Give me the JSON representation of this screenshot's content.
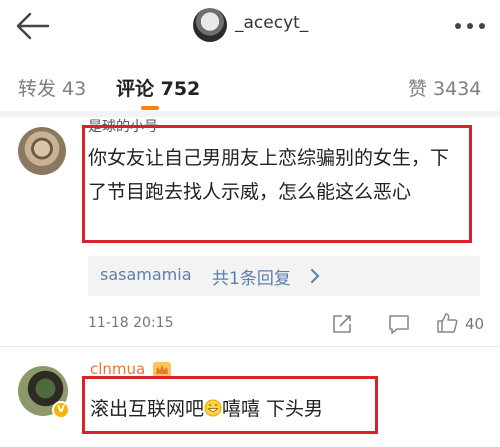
{
  "header": {
    "username": "_acecyt_",
    "back_icon": "back-arrow-icon",
    "more_icon": "more-dots-icon"
  },
  "tabs": {
    "repost": "转发 43",
    "comments": "评论 752",
    "likes": "赞 3434"
  },
  "comments": [
    {
      "username": "是球的小号",
      "text": "你女友让自己男朋友上恋综骗别的女生，下了节目跑去找人示威，怎么能这么恶心",
      "reply_preview": {
        "user": "sasamamia",
        "count_text": "共1条回复"
      },
      "date": "11-18 20:15",
      "like_count": "40"
    },
    {
      "username": "clnmua",
      "text_before_emoji": "滚出互联网吧",
      "text_after_emoji": "嘻嘻 下头男",
      "emoji": "grinning-face-icon"
    }
  ],
  "colors": {
    "accent": "#ff8200",
    "highlight_border": "#d6232c",
    "link": "#5d80ad",
    "vip_name": "#e8772c"
  }
}
